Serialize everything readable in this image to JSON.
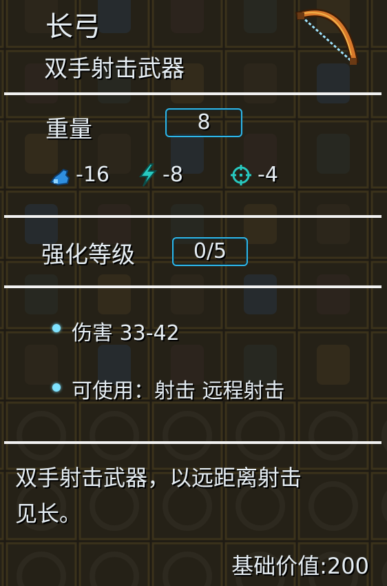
{
  "item": {
    "name": "长弓",
    "category": "双手射击武器"
  },
  "weight": {
    "label": "重量",
    "value": "8"
  },
  "modifiers": [
    {
      "icon": "strength-arm-icon",
      "value": "-16"
    },
    {
      "icon": "lightning-bolt-icon",
      "value": "-8"
    },
    {
      "icon": "crosshair-icon",
      "value": "-4"
    }
  ],
  "upgrade": {
    "label": "强化等级",
    "value": "0/5"
  },
  "stats": [
    {
      "text": "伤害 33-42"
    },
    {
      "text": "可使用：射击 远程射击"
    }
  ],
  "description": {
    "line1": "双手射击武器，以远距离射击",
    "line2": "见长。"
  },
  "base_value": "基础价值:200",
  "colors": {
    "accent": "#2fb6e8",
    "text": "#e6eef4",
    "divider": "#f2f2f2",
    "bullet": "#7fe3ff"
  }
}
